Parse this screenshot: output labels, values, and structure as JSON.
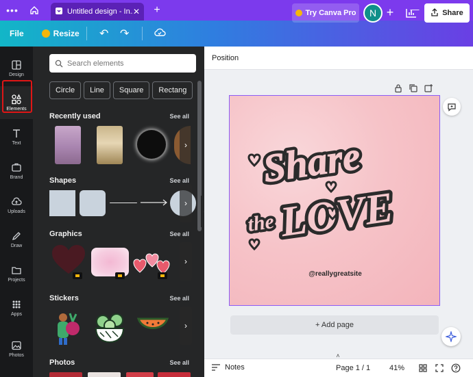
{
  "browser": {
    "tab_title": "Untitled design - In...",
    "menu_glyph": "•••",
    "tab_close": "✕",
    "new_tab": "+",
    "window": {
      "minimize": "—",
      "maximize": "☐",
      "close": "✕"
    }
  },
  "toolbar": {
    "file": "File",
    "resize": "Resize",
    "undo": "↶",
    "redo": "↷",
    "try_pro": "Try Canva Pro",
    "avatar_initial": "N",
    "add_user": "+",
    "share": "Share"
  },
  "rail": [
    {
      "label": "Design",
      "icon": "design-icon"
    },
    {
      "label": "Elements",
      "icon": "elements-icon",
      "active": true
    },
    {
      "label": "Text",
      "icon": "text-icon"
    },
    {
      "label": "Brand",
      "icon": "brand-icon"
    },
    {
      "label": "Uploads",
      "icon": "uploads-icon"
    },
    {
      "label": "Draw",
      "icon": "draw-icon"
    },
    {
      "label": "Projects",
      "icon": "projects-icon"
    },
    {
      "label": "Apps",
      "icon": "apps-icon"
    },
    {
      "label": "Photos",
      "icon": "photos-icon"
    }
  ],
  "panel": {
    "search_placeholder": "Search elements",
    "chips": [
      "Circle",
      "Line",
      "Square",
      "Rectang"
    ],
    "sections": [
      {
        "title": "Recently used",
        "see_all": "See all"
      },
      {
        "title": "Shapes",
        "see_all": "See all"
      },
      {
        "title": "Graphics",
        "see_all": "See all"
      },
      {
        "title": "Stickers",
        "see_all": "See all"
      },
      {
        "title": "Photos",
        "see_all": "See all"
      }
    ],
    "next_arrow": "›",
    "collapse_arrow": "‹"
  },
  "canvas": {
    "position_label": "Position",
    "design_text_line1": "Share",
    "design_text_line2": "the",
    "design_text_line3": "LOVE",
    "website": "@reallygreatsite",
    "add_page": "+ Add page"
  },
  "footer": {
    "notes": "Notes",
    "page": "Page 1 / 1",
    "zoom": "41%",
    "chevron_up": "˄"
  },
  "colors": {
    "brand_purple": "#7c3aed",
    "selection_border": "#8b5cf6",
    "highlight_red": "#e01616",
    "canvas_pink": "#f6c3c8"
  }
}
